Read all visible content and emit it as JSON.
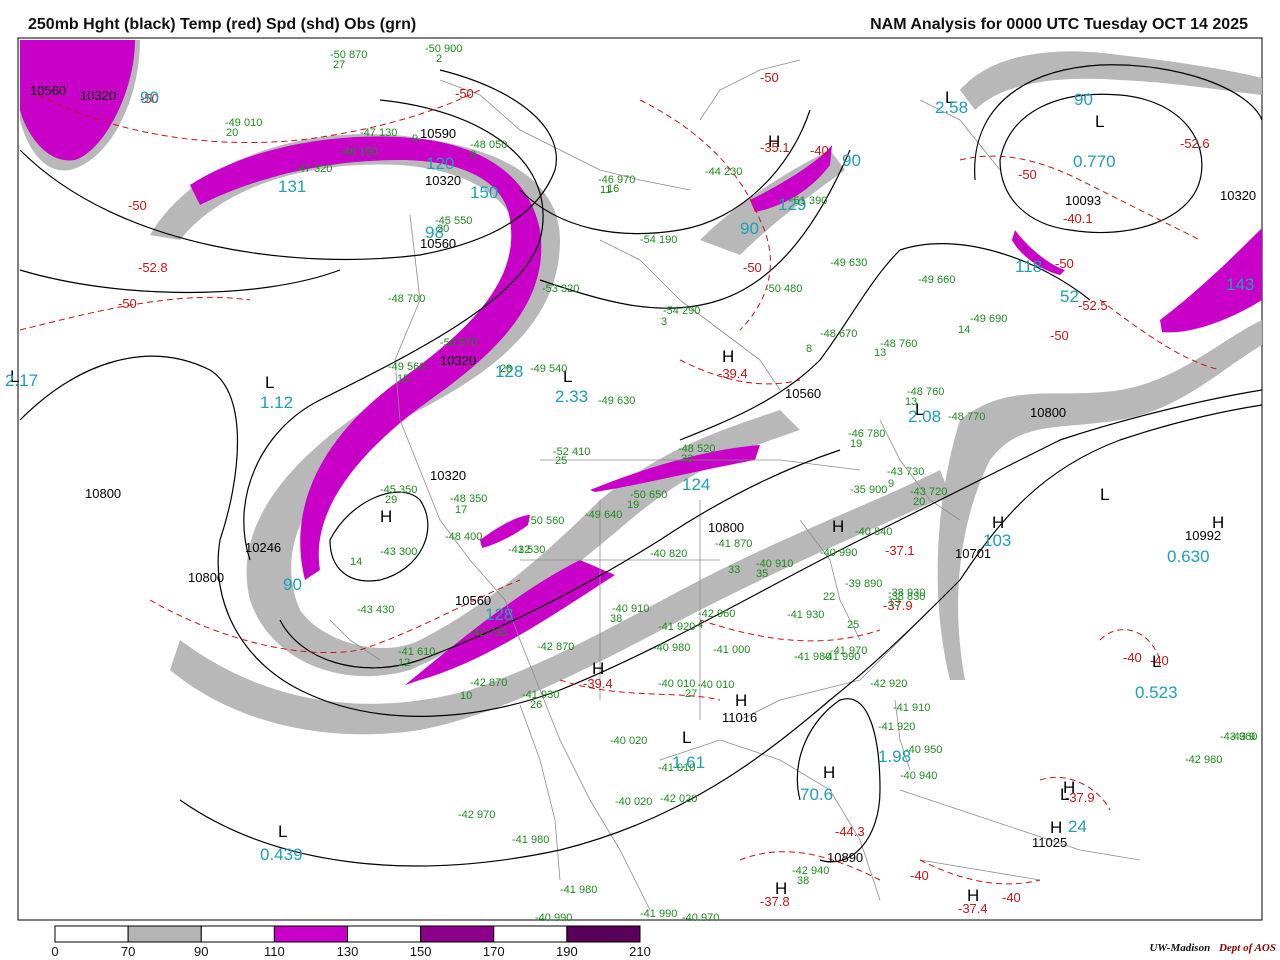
{
  "header": {
    "left_title": "250mb Hght (black) Temp (red) Spd (shd) Obs (grn)",
    "right_title": "NAM Analysis for 0000 UTC Tuesday  OCT 14 2025"
  },
  "colorbar": {
    "labels": [
      "0",
      "70",
      "90",
      "110",
      "130",
      "150",
      "170",
      "190",
      "210"
    ],
    "colors": [
      "#ffffff",
      "#b4b4b4",
      "#ffffff",
      "#c800c8",
      "#ffffff",
      "#8c008c",
      "#ffffff",
      "#5a005a"
    ]
  },
  "credit": {
    "institution": "UW-Madison",
    "dept": "Dept of AOS"
  },
  "colors": {
    "height": "#000000",
    "temp": "#c81414",
    "obs": "#1e8c1e",
    "speed_label": "#1ea0b4",
    "shade_gray": "#b4b4b4",
    "shade_magenta": "#c800c8"
  },
  "height_labels": [
    "10560",
    "10320",
    "10320",
    "10560",
    "10320",
    "10800",
    "10800",
    "10560",
    "10246",
    "10560",
    "10800",
    "10701",
    "10800",
    "10890",
    "10093",
    "10320",
    "10992",
    "11025",
    "11016",
    "10320",
    "10590"
  ],
  "temp_labels": [
    "-50",
    "-50",
    "-50",
    "-52.8",
    "-50",
    "-50",
    "-40",
    "-35.1",
    "-50",
    "-40.1",
    "-52.6",
    "-39.4",
    "-50",
    "-50",
    "-52.5",
    "-50",
    "-37.1",
    "-39.4",
    "-37.9",
    "-40",
    "-44.3",
    "-37.8",
    "-37.4",
    "-40",
    "-37.9",
    "-40",
    "-40"
  ],
  "center_labels": [
    "L",
    "L",
    "L",
    "L",
    "L",
    "L",
    "L",
    "L",
    "L",
    "L",
    "L",
    "H",
    "H",
    "H",
    "H",
    "H",
    "H",
    "H",
    "H",
    "H",
    "H",
    "H",
    "H",
    "H"
  ],
  "speed_labels": [
    "2.58",
    "0.770",
    "2.17",
    "1.12",
    "2.33",
    "2.08",
    "103",
    "0.630",
    "0.523",
    "1.61",
    "70.6",
    "1.98",
    "0.439",
    "24",
    "90",
    "90",
    "90",
    "90",
    "120",
    "131",
    "150",
    "124",
    "118",
    "143",
    "128",
    "98",
    "129",
    "90",
    "128",
    "52"
  ],
  "obs_labels": [
    "-50 870",
    "-50 900",
    "-49 010",
    "-47 130",
    "-48 050",
    "-48 150",
    "-47 320",
    "-45 550",
    "-46 970",
    "-44 230",
    "-51 390",
    "-54 190",
    "-49 630",
    "-49 660",
    "-50 480",
    "-53 320",
    "-54 290",
    "-48 670",
    "-49 690",
    "-48 760",
    "-48 700",
    "-50 570",
    "-49 560",
    "-49 630",
    "-49 540",
    "-48 760",
    "-48 770",
    "-46 780",
    "-43 730",
    "-43 720",
    "-48 350",
    "-48 400",
    "-45 350",
    "-43 300",
    "-52 410",
    "-48 520",
    "-50 650",
    "-49 640",
    "-41 530",
    "-50 560",
    "-43 430",
    "-41 610",
    "-42 730",
    "-42 870",
    "-42 870",
    "-41 930",
    "-40 820",
    "-41 870",
    "-40 910",
    "-40 910",
    "-41 920",
    "-42 960",
    "-41 930",
    "-40 980",
    "-41 980",
    "-40 010",
    "-40 010",
    "-41 000",
    "-41 990",
    "-41 970",
    "-42 920",
    "-41 910",
    "-40 950",
    "-41 920",
    "-40 940",
    "-39 890",
    "-38 930",
    "-40 840",
    "-40 990",
    "-43 960",
    "-42 980",
    "-43 9",
    "-40 020",
    "-41 010",
    "-42 020",
    "-42 970",
    "-41 980",
    "-41 980",
    "-40 990",
    "-41 990",
    "-40 970",
    "-42 940",
    "-38 830",
    "-35 900",
    "-40 020"
  ],
  "obs_counts": [
    "27",
    "2",
    "20",
    "9",
    "8",
    "16",
    "3",
    "20",
    "11",
    "28",
    "15",
    "8",
    "13",
    "14",
    "19",
    "13",
    "9",
    "20",
    "17",
    "29",
    "25",
    "33",
    "19",
    "32",
    "14",
    "12",
    "10",
    "26",
    "33",
    "35",
    "38",
    "27",
    "4",
    "22",
    "25",
    "13",
    "38"
  ]
}
